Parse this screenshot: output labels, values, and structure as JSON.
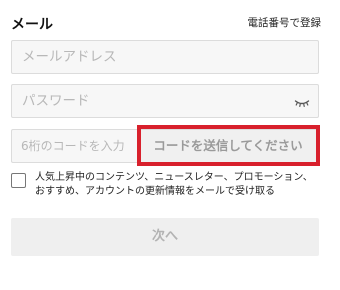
{
  "header": {
    "title": "メール",
    "phone_register_link": "電話番号で登録"
  },
  "email": {
    "placeholder": "メールアドレス",
    "value": ""
  },
  "password": {
    "placeholder": "パスワード",
    "value": "",
    "toggle_icon": "eye-closed-icon"
  },
  "code": {
    "placeholder": "6桁のコードを入力",
    "value": "",
    "send_button_label": "コードを送信してください"
  },
  "newsletter": {
    "checked": false,
    "line1": "人気上昇中のコンテンツ、ニュースレター、プロモーション、",
    "line2": "おすすめ、アカウントの更新情報をメールで受け取る"
  },
  "next_button_label": "次へ",
  "colors": {
    "highlight": "#d8202c",
    "field_background": "#f7f7f7",
    "disabled_text": "#b3b3b3"
  }
}
